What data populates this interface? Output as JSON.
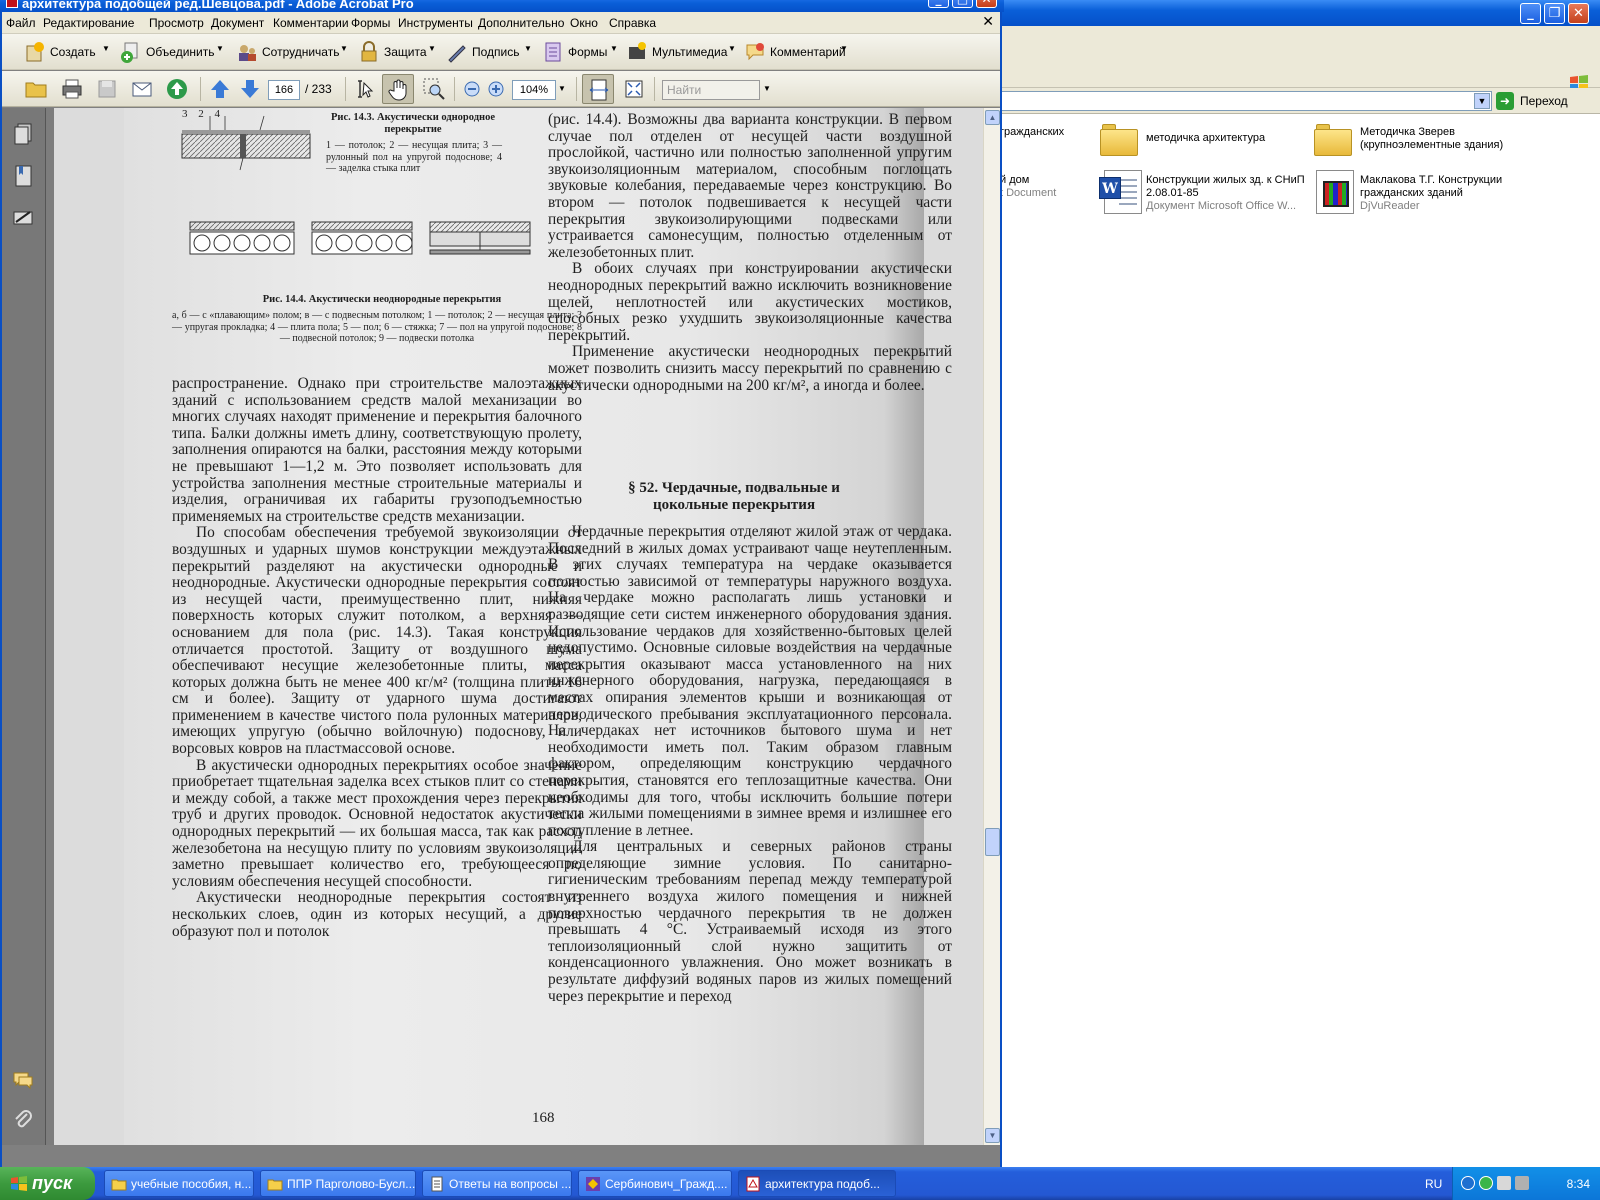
{
  "explorer": {
    "go_label": "Переход",
    "items": [
      {
        "title": "гражданских",
        "subtitle": ""
      },
      {
        "title": "методичка архитектура",
        "subtitle": ""
      },
      {
        "title": "Методичка Зверев (крупноэлементные здания)",
        "subtitle": ""
      },
      {
        "title": "й дом",
        "subtitle": "t Document"
      },
      {
        "title": "Конструкции жилых зд. к СНиП 2.08.01-85",
        "subtitle": "Документ Microsoft Office W..."
      },
      {
        "title": "Маклакова Т.Г. Конструкции гражданских зданий",
        "subtitle": "DjVuReader"
      }
    ]
  },
  "acrobat": {
    "title": "архитектура подобщей ред.Шевцова.pdf - Adobe Acrobat Pro",
    "menu": [
      "Файл",
      "Редактирование",
      "Просмотр",
      "Документ",
      "Комментарии",
      "Формы",
      "Инструменты",
      "Дополнительно",
      "Окно",
      "Справка"
    ],
    "tasks": [
      "Создать",
      "Объединить",
      "Сотрудничать",
      "Защита",
      "Подпись",
      "Формы",
      "Мультимедиа",
      "Комментарий"
    ],
    "nav": {
      "page_current": "166",
      "page_total": "/ 233",
      "zoom": "104%",
      "find_placeholder": "Найти"
    }
  },
  "page": {
    "fig143_labels": "3  2     4",
    "fig143_caption_title": "Рис. 14.3. Акустически однородное перекрытие",
    "fig143_caption_text": "1 — потолок; 2 — несущая плита; 3 — рулонный пол на упругой подоснове; 4 — заделка стыка плит",
    "fig144_caption_title": "Рис. 14.4. Акустически неоднородные перекрытия",
    "fig144_caption_text": "а, б — с «плавающим» полом; в — с подвесным потолком; 1 — потолок; 2 — несущая плита; 3 — упругая прокладка; 4 — плита пола; 5 — пол; 6 — стяжка; 7 — пол на упругой подоснове; 8 — подвесной потолок; 9 — подвески потолка",
    "left_col": [
      "распространение. Однако при строительстве малоэтажных зданий с использованием средств малой механизации во многих случаях находят применение и перекрытия балочного типа. Балки должны иметь длину, соответствующую пролету, заполнения опираются на балки, расстояния между которыми не превышают 1—1,2 м. Это позволяет использовать для устройства заполнения местные строительные материалы и изделия, ограничивая их габариты грузоподъемностью применяемых на строительстве средств механизации.",
      "По способам обеспечения требуемой звукоизоляции от воздушных и ударных шумов конструкции междуэтажных перекрытий разделяют на акустически однородные и неоднородные. Акустически однородные перекрытия состоят из несущей части, преимущественно плит, нижняя поверхность которых служит потолком, а верхняя — основанием для пола (рис. 14.3). Такая конструкция отличается простотой. Защиту от воздушного шума обеспечивают несущие железобетонные плиты, масса которых должна быть не менее 400 кг/м² (толщина плиты 16 см и более). Защиту от ударного шума достигают применением в качестве чистого пола рулонных материалов, имеющих упругую (обычно войлочную) подоснову, или ворсовых ковров на пластмассовой основе.",
      "В акустически однородных перекрытиях особое значение приобретает тщательная заделка всех стыков плит со стенами и между собой, а также мест прохождения через перекрытия труб и других проводок. Основной недостаток акустически однородных перекрытий — их большая масса, так как расход железобетона на несущую плиту по условиям звукоизоляции заметно превышает количество его, требующееся по условиям обеспечения несущей способности.",
      "Акустически неоднородные перекрытия состоят из нескольких слоев, один из которых несущий, а другие образуют пол и потолок"
    ],
    "right_col_top": [
      "(рис. 14.4). Возможны два варианта конструкции. В первом случае пол отделен от несущей части воздушной прослойкой, частично или полностью заполненной упругим звукоизоляционным материалом, способным поглощать звуковые колебания, передаваемые через конструкцию. Во втором — потолок подвешивается к несущей части перекрытия звукоизолирующими подвесками или устраивается самонесущим, полностью отделенным от железобетонных плит.",
      "В обоих случаях при конструировании акустически неоднородных перекрытий важно исключить возникновение щелей, неплотностей или акустических мостиков, способных резко ухудшить звукоизоляционные качества перекрытий.",
      "Применение акустически неоднородных перекрытий может позволить снизить массу перекрытий по сравнению с акустически однородными на 200 кг/м², а иногда и более."
    ],
    "section_heading": "§ 52. Чердачные, подвальные и цокольные перекрытия",
    "right_col_bottom": [
      "Чердачные перекрытия отделяют жилой этаж от чердака. Последний в жилых домах устраивают чаще неутепленным. В этих случаях температура на чердаке оказывается полностью зависимой от температуры наружного воздуха. На чердаке можно располагать лишь установки и разводящие сети систем инженерного оборудования здания. Использование чердаков для хозяйственно-бытовых целей недопустимо. Основные силовые воздействия на чердачные перекрытия оказывают масса установленного на них инженерного оборудования, нагрузка, передающаяся в местах опирания элементов крыши и возникающая от периодического пребывания эксплуатационного персонала. На чердаках нет источников бытового шума и нет необходимости иметь пол. Таким образом главным фактором, определяющим конструкцию чердачного перекрытия, становятся его теплозащитные качества. Они необходимы для того, чтобы исключить большие потери тепла жилыми помещениями в зимнее время и излишнее его поступление в летнее.",
      "Для центральных и северных районов страны определяющие зимние условия. По санитарно-гигиеническим требованиям перепад между температурой внутреннего воздуха жилого помещения и нижней поверхностью чердачного перекрытия τв не должен превышать 4 °С. Устраиваемый исходя из этого теплоизоляционный слой нужно защитить от конденсационного увлажнения. Оно может возникать в результате диффузий водяных паров из жилых помещений через перекрытие и переход"
    ],
    "page_number": "168"
  },
  "taskbar": {
    "start": "пуск",
    "tasks": [
      "учебные пособия, н...",
      "ППР Парголово-Бусл...",
      "Ответы на вопросы ...",
      "Сербинович_Гражд....",
      "архитектура подоб..."
    ],
    "lang": "RU",
    "clock": "8:34"
  }
}
